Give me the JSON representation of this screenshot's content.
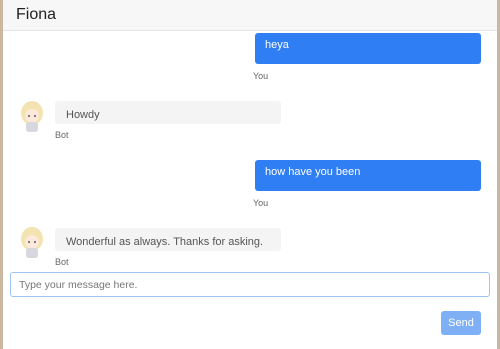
{
  "header": {
    "title": "Fiona"
  },
  "messages": [
    {
      "sender": "You",
      "text": "heya"
    },
    {
      "sender": "Bot",
      "text": "Howdy"
    },
    {
      "sender": "You",
      "text": "how have you been"
    },
    {
      "sender": "Bot",
      "text": "Wonderful as always. Thanks for asking."
    }
  ],
  "composer": {
    "placeholder": "Type your message here.",
    "send_label": "Send"
  },
  "colors": {
    "user_bubble": "#2f7ef4",
    "send_button": "#7fb0f5"
  }
}
